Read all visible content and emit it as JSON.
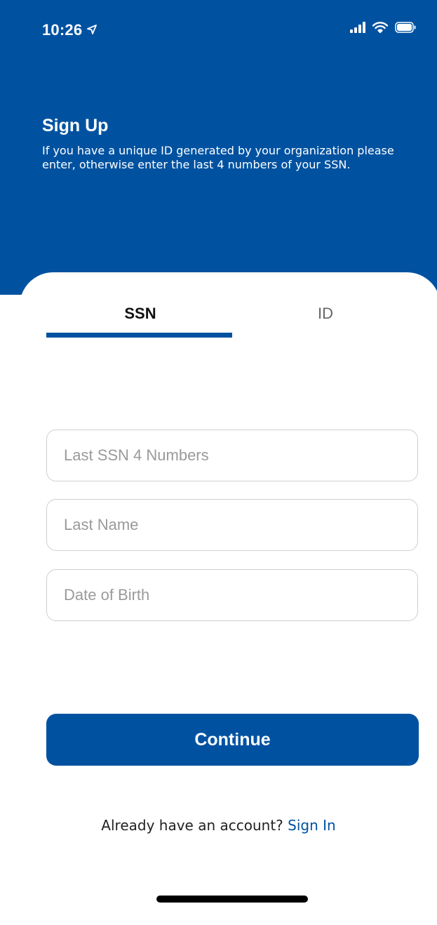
{
  "status_bar": {
    "time": "10:26",
    "location_icon": "location-arrow-icon",
    "signal_icon": "cellular-signal-icon",
    "wifi_icon": "wifi-icon",
    "battery_icon": "battery-icon"
  },
  "header": {
    "title": "Sign Up",
    "subtitle": "If you have a unique ID generated by your organization please enter, otherwise enter the last 4 numbers of your SSN."
  },
  "tabs": [
    {
      "label": "SSN",
      "active": true
    },
    {
      "label": "ID",
      "active": false
    }
  ],
  "form": {
    "ssn_placeholder": "Last SSN 4 Numbers",
    "ssn_value": "",
    "last_name_placeholder": "Last Name",
    "last_name_value": "",
    "dob_placeholder": "Date of Birth",
    "dob_value": ""
  },
  "actions": {
    "continue_label": "Continue"
  },
  "footer": {
    "prompt": "Already have an account?",
    "sign_in_label": "Sign In"
  },
  "colors": {
    "brand_blue": "#0052A1",
    "input_border": "#cfcfcf",
    "placeholder_gray": "#9a9a9a"
  }
}
